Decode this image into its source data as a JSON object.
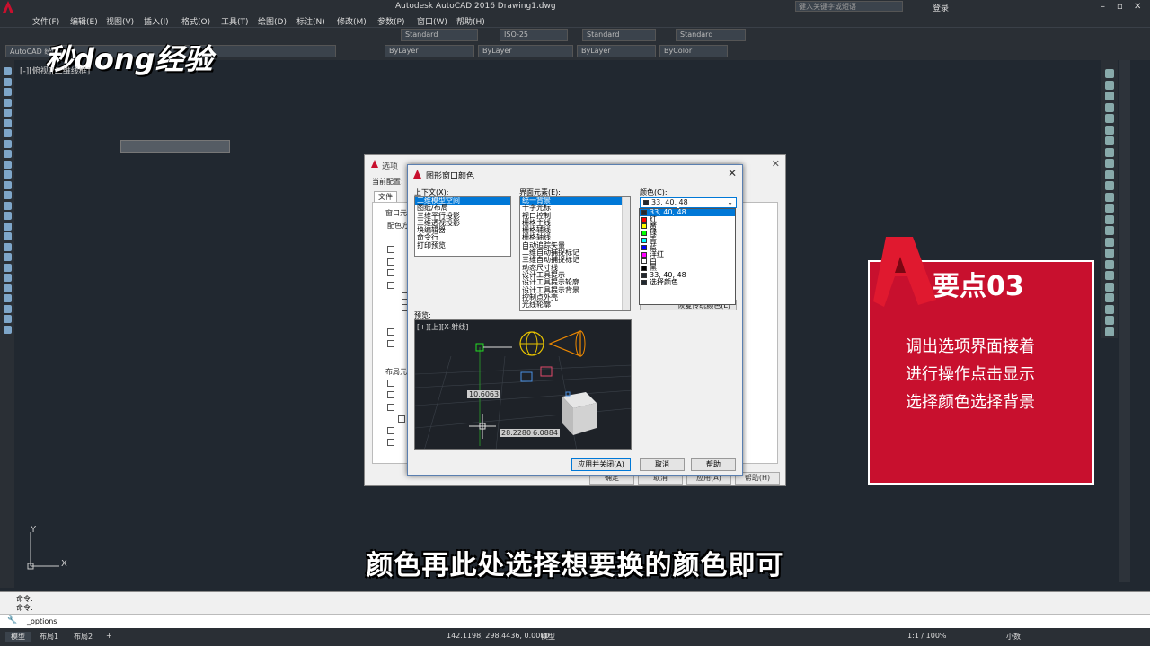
{
  "app": {
    "title": "Autodesk AutoCAD 2016    Drawing1.dwg",
    "search_placeholder": "键入关键字或短语",
    "login": "登录"
  },
  "menu": [
    "文件(F)",
    "编辑(E)",
    "视图(V)",
    "插入(I)",
    "格式(O)",
    "工具(T)",
    "绘图(D)",
    "标注(N)",
    "修改(M)",
    "参数(P)",
    "窗口(W)",
    "帮助(H)"
  ],
  "toolbar": {
    "text_style": "Standard",
    "dim_style": "ISO-25",
    "table_style": "Standard",
    "mleader_style": "Standard",
    "workspace": "AutoCAD 经典",
    "layer_color": "ByLayer",
    "linetype": "ByLayer",
    "lineweight": "ByLayer",
    "plotstyle": "ByColor"
  },
  "watermark": "秒dong经验",
  "viewport_label": "[-][俯视][二维线框]",
  "options_dialog": {
    "title": "选项",
    "current_profile": "当前配置:",
    "tab_file": "文件",
    "window_elements": "窗口元素",
    "color_scheme": "配色方",
    "layout_elements": "布局元",
    "ok": "确定",
    "cancel": "取消",
    "apply": "应用(A)",
    "help": "帮助(H)"
  },
  "color_dialog": {
    "title": "图形窗口颜色",
    "context_label": "上下文(X):",
    "context_items": [
      "二维模型空间",
      "图纸/布局",
      "三维平行投影",
      "三维透视投影",
      "块编辑器",
      "命令行",
      "打印预览"
    ],
    "element_label": "界面元素(E):",
    "element_items": [
      "统一背景",
      "十字光标",
      "视口控制",
      "栅格主线",
      "栅格辅线",
      "栅格轴线",
      "自动追踪矢量",
      "二维自动捕捉标记",
      "三维自动捕捉标记",
      "动态尺寸线",
      "设计工具提示",
      "设计工具提示轮廓",
      "设计工具提示背景",
      "控制点外壳",
      "光线轮廓"
    ],
    "color_label": "颜色(C):",
    "color_value": "33, 40, 48",
    "restore_label": "恢复传统颜色(L)",
    "preview_label": "预览:",
    "preview_view": "[+][上][X-射线]",
    "dim1": "10.6063",
    "dim2": "28.2280",
    "dim3": "6.0884",
    "apply_close": "应用并关闭(A)",
    "cancel": "取消",
    "help": "帮助"
  },
  "color_options": [
    {
      "label": "33, 40, 48",
      "hex": "#212830",
      "selected": true
    },
    {
      "label": "红",
      "hex": "#ff0000"
    },
    {
      "label": "黄",
      "hex": "#ffff00"
    },
    {
      "label": "绿",
      "hex": "#00ff00"
    },
    {
      "label": "青",
      "hex": "#00ffff"
    },
    {
      "label": "蓝",
      "hex": "#0000ff"
    },
    {
      "label": "洋红",
      "hex": "#ff00ff"
    },
    {
      "label": "白",
      "hex": "#ffffff"
    },
    {
      "label": "黑",
      "hex": "#000000"
    },
    {
      "label": "33, 40, 48",
      "hex": "#212830"
    },
    {
      "label": "选择颜色...",
      "hex": "#212830"
    }
  ],
  "card": {
    "heading": "要点03",
    "lines": [
      "调出选项界面接着",
      "进行操作点击显示",
      "选择颜色选择背景"
    ]
  },
  "subtitle": "颜色再此处选择想要换的颜色即可",
  "command": {
    "line1": "命令:",
    "line2": "命令:",
    "input": "_options"
  },
  "status": {
    "tab_model": "模型",
    "tab_layout1": "布局1",
    "tab_layout2": "布局2",
    "coords": "142.1198, 298.4436, 0.0000",
    "model": "模型",
    "scale": "1:1 / 100%",
    "units": "小数"
  },
  "accent_colors": {
    "title_bg": "#2a2f35",
    "canvas": "#212830",
    "select": "#0078d7",
    "card": "#c8102e"
  }
}
